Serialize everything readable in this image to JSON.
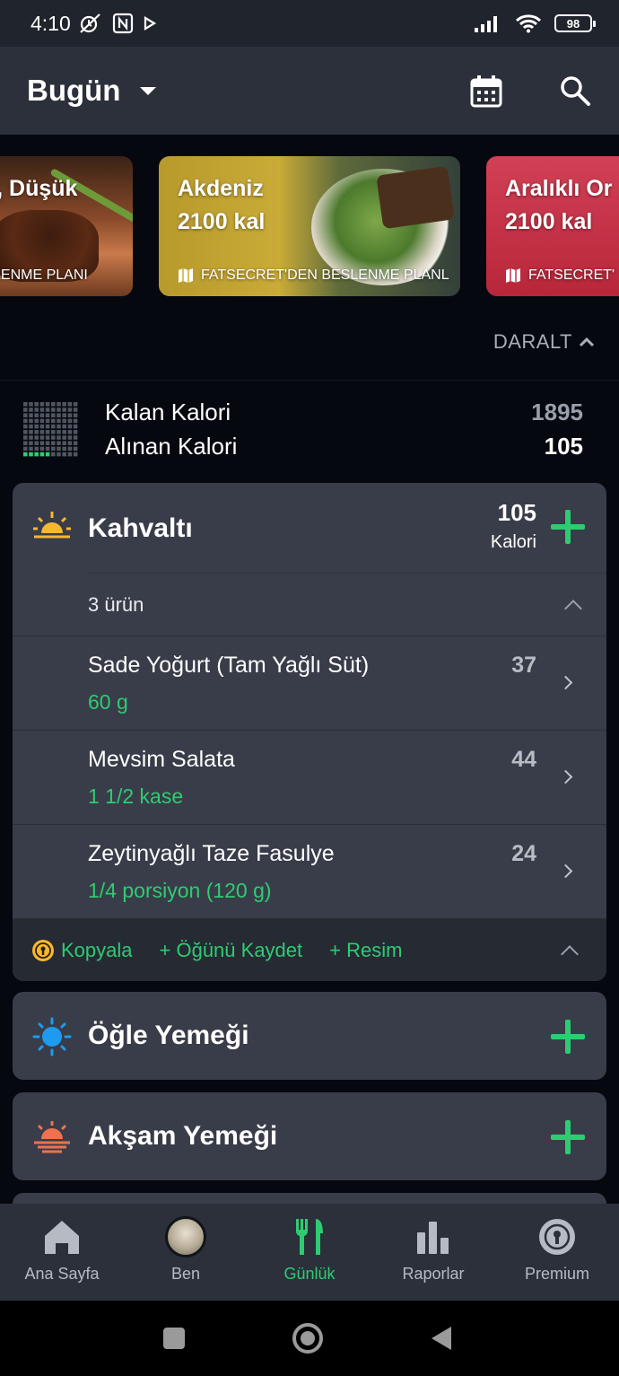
{
  "status_bar": {
    "time": "4:10",
    "battery": "98"
  },
  "header": {
    "title": "Bugün"
  },
  "plans": [
    {
      "title": "ein, Düşük",
      "subtitle": "BESLENME PLANI"
    },
    {
      "title": "Akdeniz",
      "calories": "2100 kal",
      "subtitle": "FATSECRET'DEN BESLENME PLANL"
    },
    {
      "title": "Aralıklı Or",
      "calories": "2100 kal",
      "subtitle": "FATSECRET'"
    }
  ],
  "collapse_label": "DARALT",
  "summary": {
    "remaining_label": "Kalan Kalori",
    "remaining_value": "1895",
    "consumed_label": "Alınan Kalori",
    "consumed_value": "105"
  },
  "breakfast": {
    "name": "Kahvaltı",
    "calories": "105",
    "calories_unit": "Kalori",
    "item_count": "3 ürün",
    "items": [
      {
        "name": "Sade Yoğurt (Tam Yağlı Süt)",
        "portion": "60 g",
        "calories": "37"
      },
      {
        "name": "Mevsim Salata",
        "portion": "1 1/2 kase",
        "calories": "44"
      },
      {
        "name": "Zeytinyağlı Taze Fasulye",
        "portion": "1/4 porsiyon (120 g)",
        "calories": "24"
      }
    ],
    "actions": {
      "copy": "Kopyala",
      "save_meal": "+ Öğünü Kaydet",
      "photo": "+ Resim"
    }
  },
  "lunch": {
    "name": "Öğle Yemeği"
  },
  "dinner": {
    "name": "Akşam Yemeği"
  },
  "bottom_nav": [
    {
      "label": "Ana Sayfa",
      "icon": "home-icon"
    },
    {
      "label": "Ben",
      "icon": "avatar"
    },
    {
      "label": "Günlük",
      "icon": "fork-knife-icon"
    },
    {
      "label": "Raporlar",
      "icon": "bar-chart-icon"
    },
    {
      "label": "Premium",
      "icon": "premium-badge-icon"
    }
  ],
  "colors": {
    "accent": "#2ecc71",
    "card": "#393d49",
    "background": "#05080f"
  }
}
